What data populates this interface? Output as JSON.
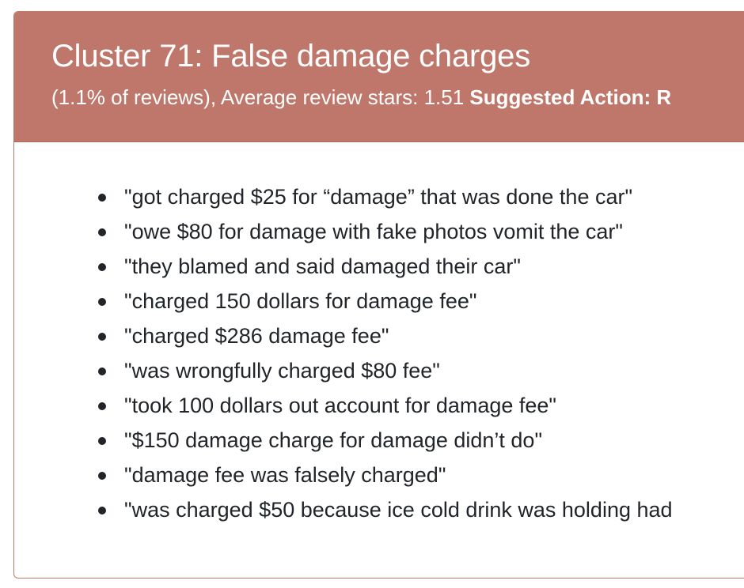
{
  "header": {
    "title": "Cluster 71: False damage charges",
    "stats": "(1.1% of reviews), Average review stars: 1.51 ",
    "action_label": "Suggested Action: R"
  },
  "quotes": [
    "\"got charged $25 for “damage” that was done the car\"",
    "\"owe $80 for damage with fake photos vomit the car\"",
    "\"they blamed and said damaged their car\"",
    "\"charged 150 dollars for damage fee\"",
    "\"charged $286 damage fee\"",
    "\"was wrongfully charged $80 fee\"",
    "\"took 100 dollars out account for damage fee\"",
    "\"$150 damage charge for damage didn’t do\"",
    "\"damage fee was falsely charged\"",
    "\"was charged $50 because ice cold drink was holding had"
  ],
  "colors": {
    "header_bg": "#be776a",
    "border": "#c0786b",
    "text": "#212529"
  }
}
